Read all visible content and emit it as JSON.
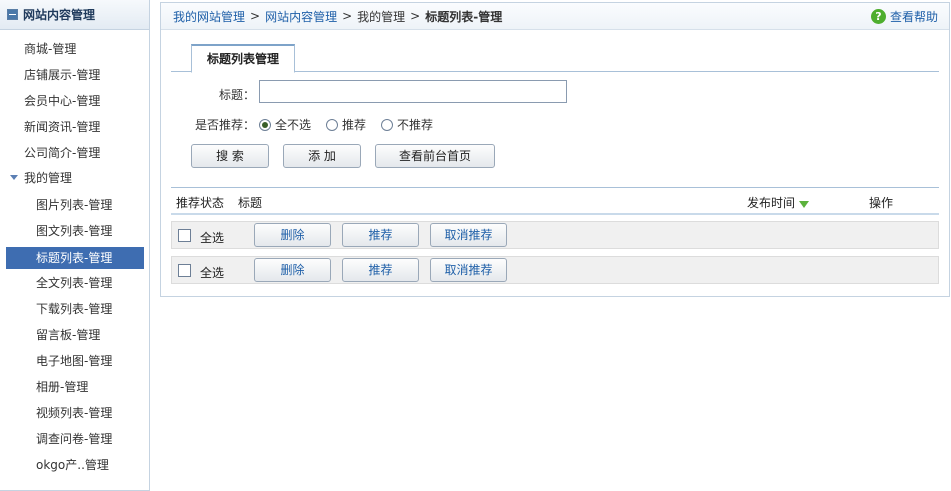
{
  "sidebar": {
    "title": "网站内容管理",
    "items": [
      {
        "label": "商城-管理"
      },
      {
        "label": "店铺展示-管理"
      },
      {
        "label": "会员中心-管理"
      },
      {
        "label": "新闻资讯-管理"
      },
      {
        "label": "公司简介-管理"
      },
      {
        "label": "我的管理"
      },
      {
        "label": "图片列表-管理"
      },
      {
        "label": "图文列表-管理"
      },
      {
        "label": "标题列表-管理"
      },
      {
        "label": "全文列表-管理"
      },
      {
        "label": "下载列表-管理"
      },
      {
        "label": "留言板-管理"
      },
      {
        "label": "电子地图-管理"
      },
      {
        "label": "相册-管理"
      },
      {
        "label": "视频列表-管理"
      },
      {
        "label": "调查问卷-管理"
      },
      {
        "label": "okgo产..管理"
      }
    ]
  },
  "breadcrumb": {
    "sep": ">",
    "items": [
      "我的网站管理",
      "网站内容管理",
      "我的管理",
      "标题列表-管理"
    ]
  },
  "help": {
    "label": "查看帮助"
  },
  "tab": {
    "label": "标题列表管理"
  },
  "form": {
    "title_label": "标题：",
    "title_value": "",
    "recommend_label": "是否推荐：",
    "options": [
      "全不选",
      "推荐",
      "不推荐"
    ],
    "selected": "全不选",
    "search_label": "搜 索",
    "add_label": "添 加",
    "view_front_label": "查看前台首页"
  },
  "list": {
    "columns": {
      "status": "推荐状态",
      "title": "标题",
      "publish_time": "发布时间",
      "actions": "操作"
    },
    "rows": [
      {
        "select_all": "全选",
        "delete": "删除",
        "recommend": "推荐",
        "cancel_recommend": "取消推荐"
      },
      {
        "select_all": "全选",
        "delete": "删除",
        "recommend": "推荐",
        "cancel_recommend": "取消推荐"
      }
    ]
  },
  "colors": {
    "accent": "#3e6db1",
    "link": "#1e5fa8",
    "help_icon": "#4eae2e",
    "sort_arrow": "#5cb23c"
  }
}
